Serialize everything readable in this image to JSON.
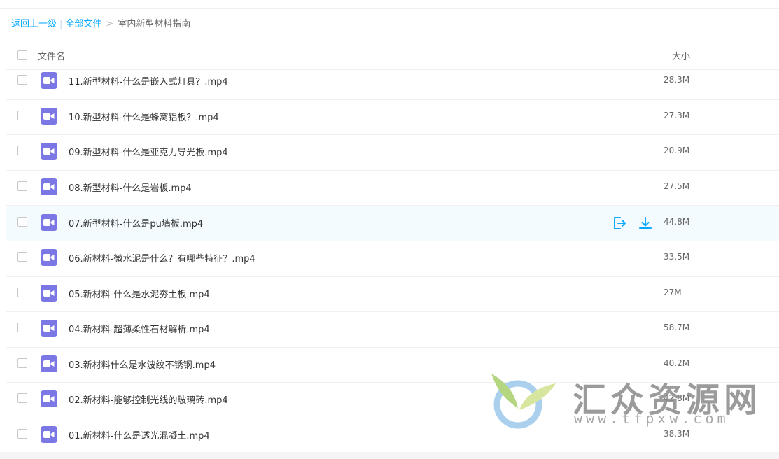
{
  "breadcrumb": {
    "back": "返回上一级",
    "separator": "|",
    "all_files": "全部文件",
    "arrow": ">",
    "current": "室内新型材料指南"
  },
  "header": {
    "name_label": "文件名",
    "size_label": "大小"
  },
  "files": [
    {
      "name": "11.新型材料-什么是嵌入式灯具？.mp4",
      "size": "28.3M"
    },
    {
      "name": "10.新型材料-什么是蜂窝铝板？.mp4",
      "size": "27.3M"
    },
    {
      "name": "09.新型材料-什么是亚克力导光板.mp4",
      "size": "20.9M"
    },
    {
      "name": "08.新型材料-什么是岩板.mp4",
      "size": "27.5M"
    },
    {
      "name": "07.新型材料-什么是pu墙板.mp4",
      "size": "44.8M"
    },
    {
      "name": "06.新材料-微水泥是什么？有哪些特征？.mp4",
      "size": "33.5M"
    },
    {
      "name": "05.新材料-什么是水泥夯土板.mp4",
      "size": "27M"
    },
    {
      "name": "04.新材料-超薄柔性石材解析.mp4",
      "size": "58.7M"
    },
    {
      "name": "03.新材料什么是水波纹不锈钢.mp4",
      "size": "40.2M"
    },
    {
      "name": "02.新材料-能够控制光线的玻璃砖.mp4",
      "size": "42.8M"
    },
    {
      "name": "01.新材料-什么是透光混凝土.mp4",
      "size": "38.3M"
    }
  ],
  "watermark": {
    "title": "汇众资源网",
    "url": "www.tfpxw.com"
  },
  "colors": {
    "link": "#09aaff",
    "file_icon": "#7b78e6",
    "action_icon": "#09aaff",
    "hover_row": "#f4fbff"
  }
}
